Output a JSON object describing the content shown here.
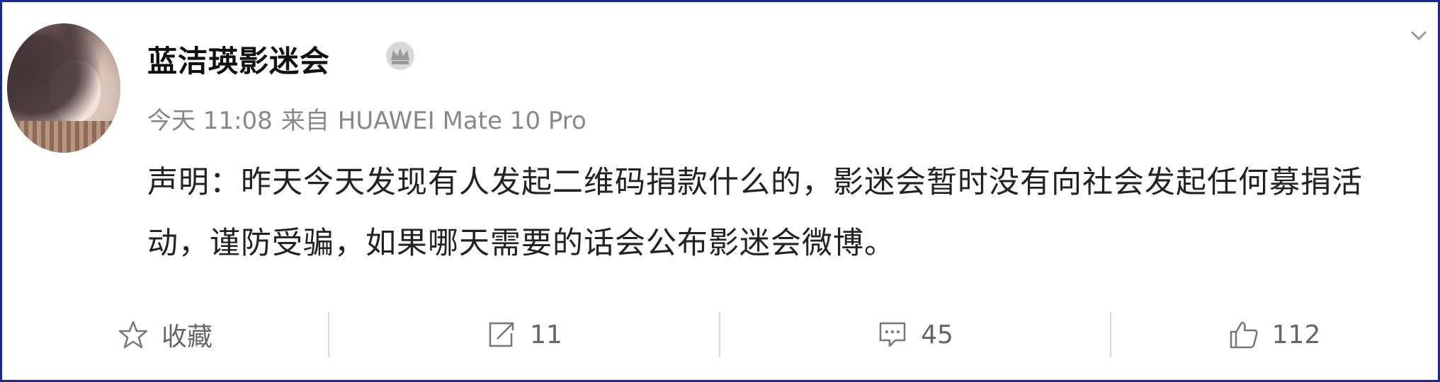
{
  "post": {
    "author": "蓝洁瑛影迷会",
    "time": "今天 11:08",
    "source_prefix": "来自",
    "device": "HUAWEI Mate 10 Pro",
    "content": "声明：昨天今天发现有人发起二维码捐款什么的，影迷会暂时没有向社会发起任何募捐活动，谨防受骗，如果哪天需要的话会公布影迷会微博。"
  },
  "actions": {
    "favorite_label": "收藏",
    "repost_count": "11",
    "comment_count": "45",
    "like_count": "112"
  },
  "colors": {
    "border": "#1a2a8a",
    "text": "#222222",
    "meta": "#888888",
    "action": "#666666"
  },
  "icons": {
    "vip": "crown-icon",
    "menu": "chevron-down-icon",
    "favorite": "star-icon",
    "repost": "repost-icon",
    "comment": "comment-icon",
    "like": "thumbs-up-icon"
  }
}
